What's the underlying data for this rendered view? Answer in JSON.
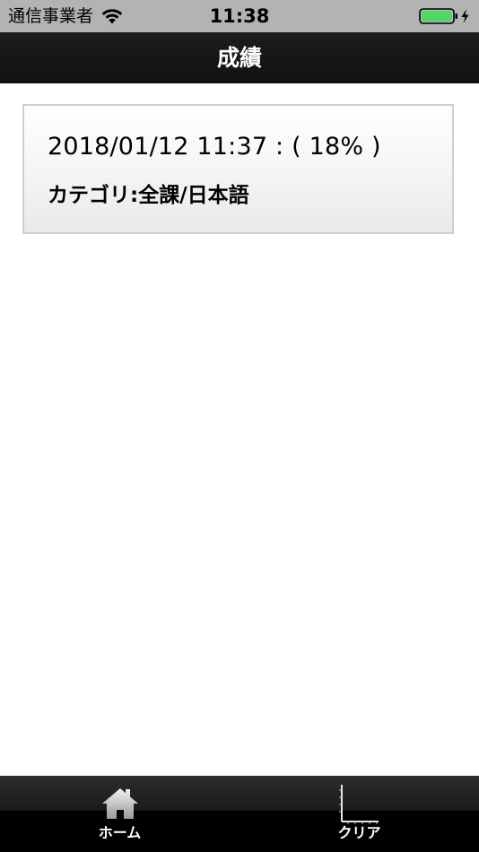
{
  "status_bar": {
    "carrier": "通信事業者",
    "time": "11:38",
    "wifi_icon": "wifi-icon",
    "battery_icon": "battery-charging-icon",
    "battery_color": "#4cd964"
  },
  "nav": {
    "title": "成績"
  },
  "records": [
    {
      "datetime_score": "2018/01/12 11:37 : ( 18% )",
      "category": "カテゴリ:全課/日本語"
    }
  ],
  "tabs": [
    {
      "label": "ホーム",
      "icon": "home-icon"
    },
    {
      "label": "クリア",
      "icon": "chart-icon"
    }
  ]
}
